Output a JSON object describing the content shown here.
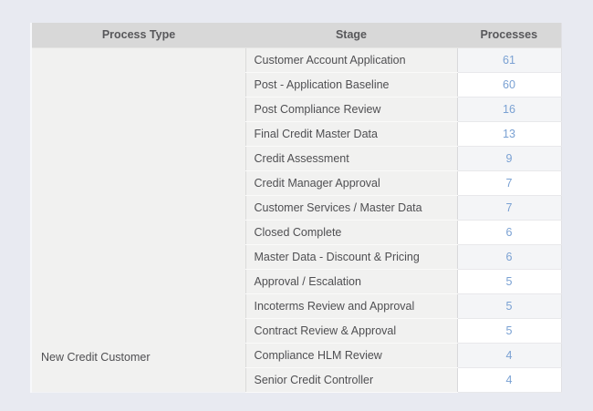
{
  "table": {
    "headers": [
      {
        "label": "Process Type"
      },
      {
        "label": "Stage"
      },
      {
        "label": "Processes"
      }
    ],
    "process_type_label": "New Credit Customer",
    "rows": [
      {
        "stage": "Customer Account Application",
        "processes": "61"
      },
      {
        "stage": "Post - Application Baseline",
        "processes": "60"
      },
      {
        "stage": "Post Compliance Review",
        "processes": "16"
      },
      {
        "stage": "Final Credit Master Data",
        "processes": "13"
      },
      {
        "stage": "Credit Assessment",
        "processes": "9"
      },
      {
        "stage": "Credit Manager Approval",
        "processes": "7"
      },
      {
        "stage": "Customer Services / Master Data",
        "processes": "7"
      },
      {
        "stage": "Closed Complete",
        "processes": "6"
      },
      {
        "stage": "Master Data - Discount & Pricing",
        "processes": "6"
      },
      {
        "stage": "Approval / Escalation",
        "processes": "5"
      },
      {
        "stage": "Incoterms Review and Approval",
        "processes": "5"
      },
      {
        "stage": "Contract Review & Approval",
        "processes": "5"
      },
      {
        "stage": "Compliance HLM Review",
        "processes": "4"
      },
      {
        "stage": "Senior Credit Controller",
        "processes": "4"
      }
    ],
    "colors": {
      "page_background": "#e8eaf1",
      "header_background": "#d8d8d8",
      "header_text": "#58585b",
      "cell_background": "#f1f1f0",
      "alt_row_background": "#f4f5f7",
      "even_row_background": "#ffffff",
      "body_text": "#4f4f52",
      "count_link": "#7aa1d3"
    }
  }
}
